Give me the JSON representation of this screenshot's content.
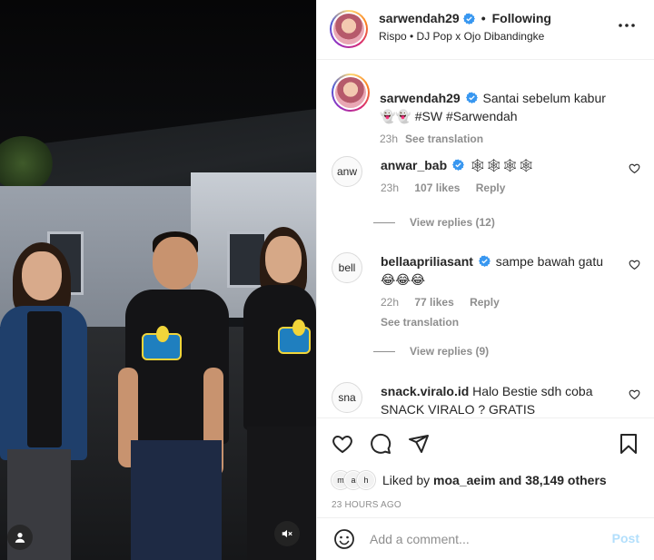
{
  "header": {
    "username": "sarwendah29",
    "separator": "•",
    "follow_state": "Following",
    "audio": "Rispo • DJ Pop x Ojo Dibandingke",
    "more_icon": "more-horizontal-icon"
  },
  "caption": {
    "username": "sarwendah29",
    "text": "Santai sebelum kabur👻👻 #SW #Sarwendah",
    "time": "23h",
    "translate": "See translation"
  },
  "comments": [
    {
      "avatar_text": "anw",
      "username": "anwar_bab",
      "text": "🕸🕸🕸🕸",
      "time": "23h",
      "likes": "107 likes",
      "reply": "Reply",
      "view_replies": "View replies (12)"
    },
    {
      "avatar_text": "bell",
      "username": "bellaapriliasant",
      "text": "sampe bawah gatu😂😂😂",
      "time": "22h",
      "likes": "77 likes",
      "reply": "Reply",
      "translate": "See translation",
      "view_replies": "View replies (9)"
    },
    {
      "avatar_text": "sna",
      "username": "snack.viralo.id",
      "text": "Halo Bestie sdh coba SNACK VIRALO ? GRATIS"
    }
  ],
  "actions": {
    "like_icon": "heart-icon",
    "comment_icon": "comment-icon",
    "share_icon": "send-icon",
    "save_icon": "bookmark-icon"
  },
  "likes": {
    "avatars": [
      "m",
      "a",
      "h"
    ],
    "prefix": "Liked by",
    "user": "moa_aeim",
    "suffix": "and 38,149 others"
  },
  "timestamp": "23 HOURS AGO",
  "add_comment": {
    "placeholder": "Add a comment...",
    "post_label": "Post"
  },
  "colors": {
    "verified": "#3897f0",
    "post_disabled": "#b2dffc",
    "muted": "#8e8e8e"
  }
}
